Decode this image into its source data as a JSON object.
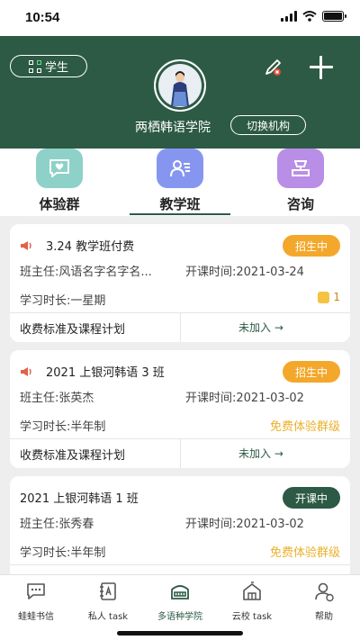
{
  "status_bar": {
    "time": "10:54"
  },
  "header": {
    "student_label": "学生",
    "school_name": "两栖韩语学院",
    "switch_label": "切换机构",
    "colors": {
      "primary": "#2d5a45"
    }
  },
  "tabs": [
    {
      "label": "体验群",
      "icon": "chat-heart-icon",
      "color": "#8ed1c8"
    },
    {
      "label": "教学班",
      "icon": "user-list-icon",
      "color": "#8696f0",
      "active": true
    },
    {
      "label": "咨询",
      "icon": "consult-icon",
      "color": "#b98ee6"
    }
  ],
  "cards": [
    {
      "title": "3.24 教学班付费",
      "status": "招生中",
      "teacher": "班主任:风语名字名字名...",
      "start": "开课时间:2021-03-24",
      "duration": "学习时长:一星期",
      "coin_count": "1",
      "fee_link": "收费标准及课程计划",
      "join": "未加入 →"
    },
    {
      "title": "2021 上银河韩语 3 班",
      "status": "招生中",
      "teacher": "班主任:张英杰",
      "start": "开课时间:2021-03-02",
      "duration": "学习时长:半年制",
      "trial": "免费体验群级",
      "fee_link": "收费标准及课程计划",
      "join": "未加入 →"
    },
    {
      "title": "2021 上银河韩语 1 班",
      "status": "开课中",
      "teacher": "班主任:张秀春",
      "start": "开课时间:2021-03-02",
      "duration": "学习时长:半年制",
      "trial": "免费体验群级"
    }
  ],
  "bottom_nav": [
    {
      "label": "蛙蛙书信",
      "icon": "chat-bubble-icon"
    },
    {
      "label": "私人 task",
      "icon": "notebook-icon"
    },
    {
      "label": "多语种学院",
      "icon": "school-icon",
      "active": true
    },
    {
      "label": "云校 task",
      "icon": "cloud-school-icon"
    },
    {
      "label": "帮助",
      "icon": "help-person-icon"
    }
  ]
}
